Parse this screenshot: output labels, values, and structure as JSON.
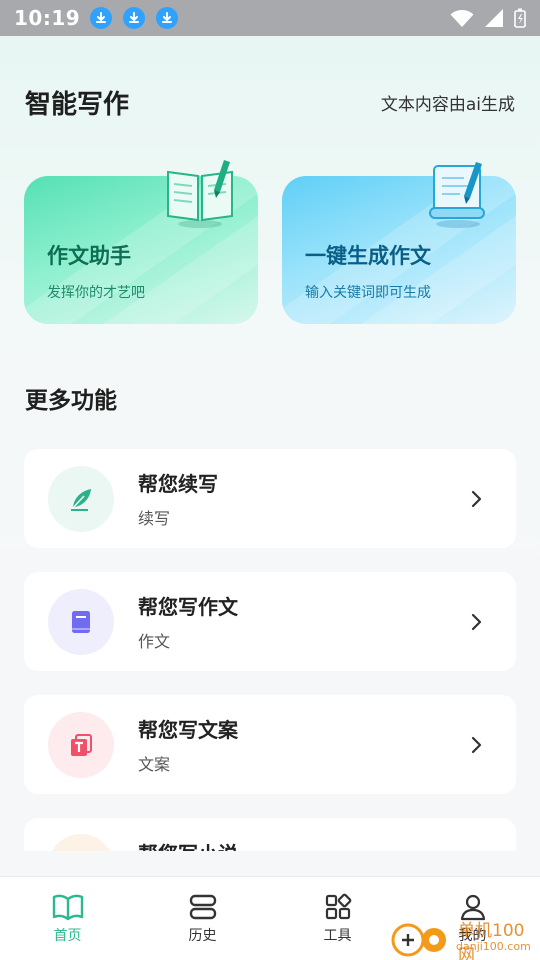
{
  "status_bar": {
    "time": "10:19",
    "notification_icons": [
      "download-icon",
      "download-icon",
      "download-icon"
    ],
    "right_icons": [
      "wifi-icon",
      "signal-icon",
      "battery-icon"
    ]
  },
  "header": {
    "title": "智能写作",
    "note": "文本内容由ai生成"
  },
  "feature_cards": [
    {
      "title": "作文助手",
      "subtitle": "发挥你的才艺吧",
      "icon": "open-book-pen-icon",
      "color": "#56e0b5"
    },
    {
      "title": "一键生成作文",
      "subtitle": "输入关键词即可生成",
      "icon": "scroll-pen-icon",
      "color": "#5fcff6"
    }
  ],
  "section_title": "更多功能",
  "list_items": [
    {
      "title": "帮您续写",
      "subtitle": "续写",
      "icon": "feather-icon",
      "color": "#2fb08c"
    },
    {
      "title": "帮您写作文",
      "subtitle": "作文",
      "icon": "book-icon",
      "color": "#6f6cf0"
    },
    {
      "title": "帮您写文案",
      "subtitle": "文案",
      "icon": "text-copy-icon",
      "color": "#f0506a"
    },
    {
      "title": "帮您写小说",
      "subtitle": "",
      "icon": "novel-icon",
      "color": "#f7a64a"
    }
  ],
  "bottom_nav": [
    {
      "label": "首页",
      "icon": "book-open-icon",
      "active": true
    },
    {
      "label": "历史",
      "icon": "history-icon",
      "active": false
    },
    {
      "label": "工具",
      "icon": "grid-icon",
      "active": false
    },
    {
      "label": "我的",
      "icon": "user-icon",
      "active": false
    }
  ],
  "watermark": {
    "text": "单机100网",
    "url_text": "danji100.com"
  }
}
